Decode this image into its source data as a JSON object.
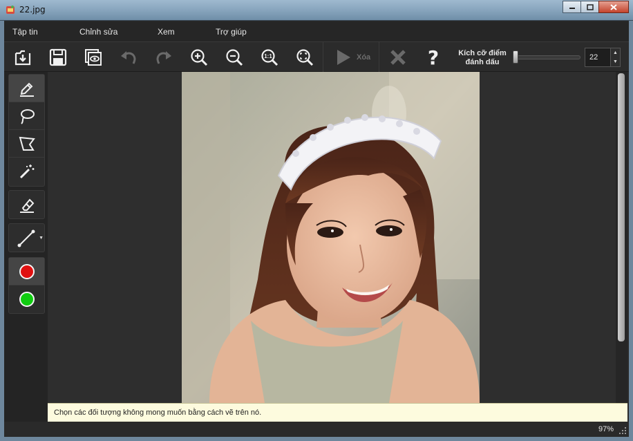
{
  "window": {
    "title": "22.jpg"
  },
  "menu": [
    "Tập tin",
    "Chỉnh sửa",
    "Xem",
    "Trợ giúp"
  ],
  "toolbar": {
    "buttons": [
      {
        "name": "open-icon"
      },
      {
        "name": "save-icon"
      },
      {
        "name": "preview-icon"
      },
      {
        "name": "undo-icon"
      },
      {
        "name": "redo-icon"
      },
      {
        "name": "zoom-in-icon"
      },
      {
        "name": "zoom-out-icon"
      },
      {
        "name": "zoom-actual-size-icon"
      },
      {
        "name": "zoom-fit-icon"
      },
      {
        "name": "play-icon"
      },
      {
        "name": "cancel-x-icon"
      },
      {
        "name": "help-icon"
      }
    ],
    "run_label": "Xóa",
    "zoom_actual_label": "1:1",
    "help_label": "?",
    "marker_size_label_line1": "Kích cỡ điểm",
    "marker_size_label_line2": "đánh dấu",
    "marker_size_value": "22"
  },
  "tools": {
    "selection": [
      "pencil-marker-icon",
      "lasso-icon",
      "polygon-lasso-icon",
      "magic-wand-icon"
    ],
    "eraser": "eraser-icon",
    "line": "line-tool-icon",
    "colors": [
      {
        "name": "red-marker",
        "color": "#e01010"
      },
      {
        "name": "green-marker",
        "color": "#10cc10"
      }
    ]
  },
  "hint": "Chọn các đối tượng không mong muốn bằng cách vẽ trên nó.",
  "status": {
    "zoom": "97%"
  }
}
